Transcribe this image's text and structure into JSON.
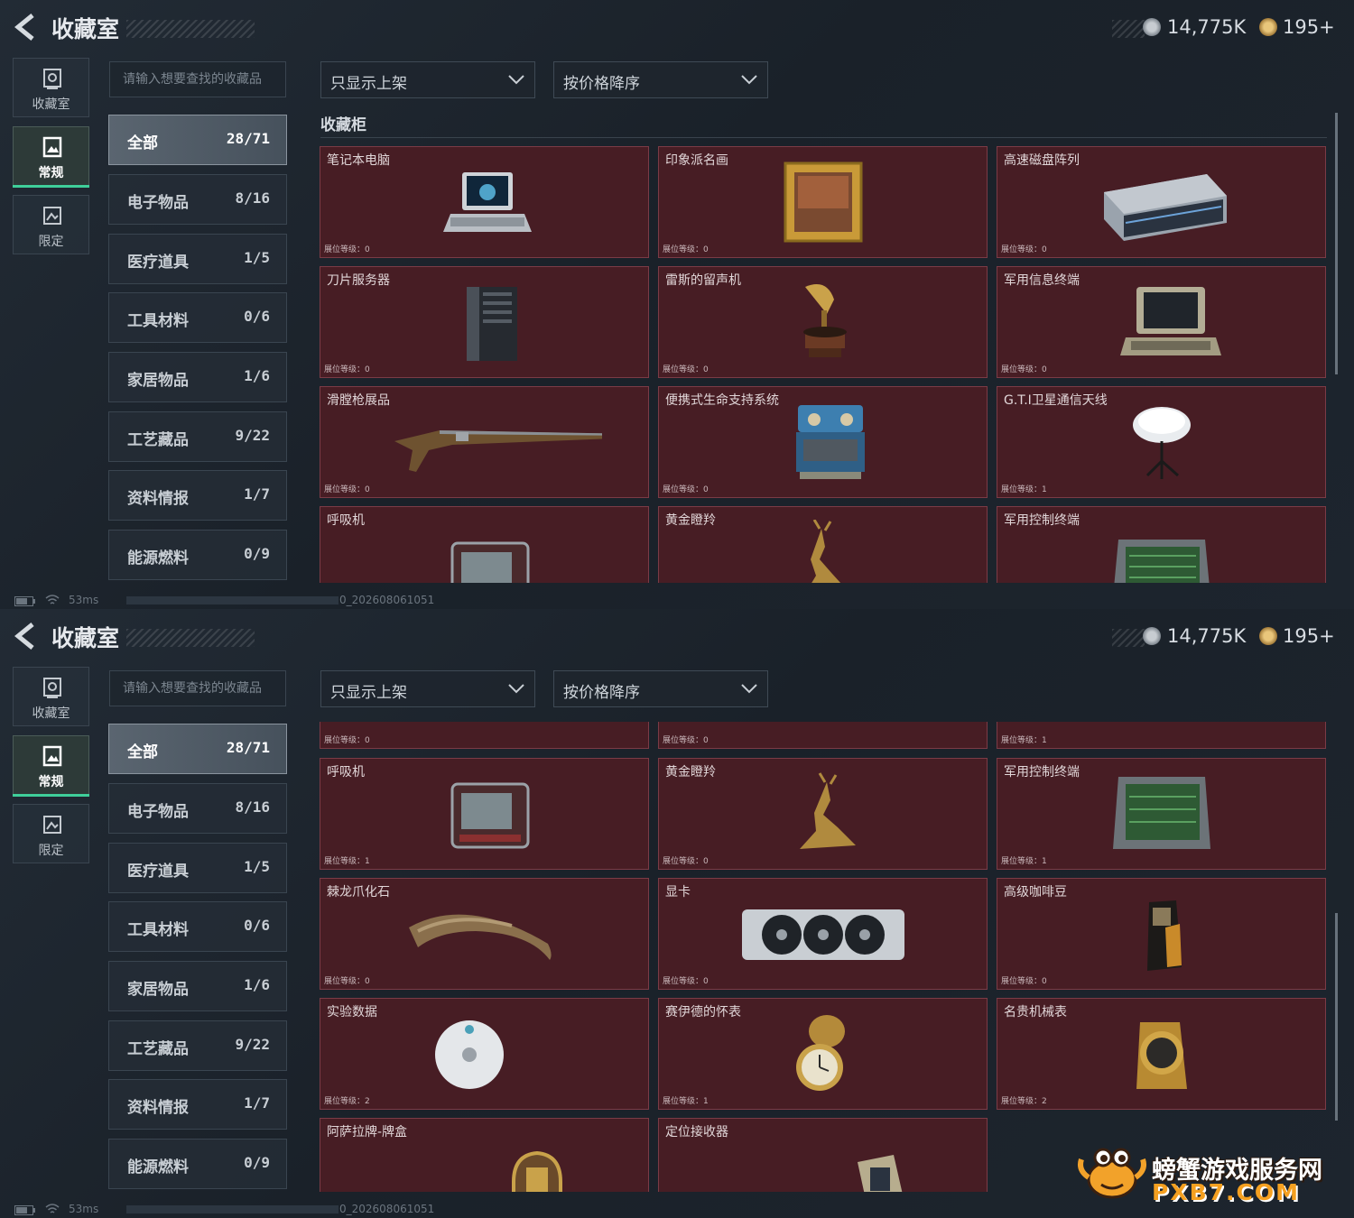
{
  "header": {
    "title": "收藏室",
    "currency": "14,775K",
    "coins": "195+"
  },
  "nav": [
    {
      "label": "收藏室",
      "icon": "vault-icon"
    },
    {
      "label": "常规",
      "icon": "picture-frame-icon",
      "active": true
    },
    {
      "label": "限定",
      "icon": "limited-image-icon"
    }
  ],
  "search": {
    "placeholder": "请输入想要查找的收藏品"
  },
  "filters": {
    "display": "只显示上架",
    "sort": "按价格降序"
  },
  "section_title": "收藏柜",
  "categories": [
    {
      "name": "全部",
      "count": "28/71",
      "active": true
    },
    {
      "name": "电子物品",
      "count": "8/16"
    },
    {
      "name": "医疗道具",
      "count": "1/5"
    },
    {
      "name": "工具材料",
      "count": "0/6"
    },
    {
      "name": "家居物品",
      "count": "1/6"
    },
    {
      "name": "工艺藏品",
      "count": "9/22"
    },
    {
      "name": "资料情报",
      "count": "1/7"
    },
    {
      "name": "能源燃料",
      "count": "0/9"
    }
  ],
  "level_label": "展位等级：",
  "items": [
    {
      "name": "笔记本电脑",
      "level": "0",
      "icon": "laptop-icon"
    },
    {
      "name": "印象派名画",
      "level": "0",
      "icon": "painting-icon"
    },
    {
      "name": "高速磁盘阵列",
      "level": "0",
      "icon": "disk-array-icon"
    },
    {
      "name": "刀片服务器",
      "level": "0",
      "icon": "server-icon"
    },
    {
      "name": "雷斯的留声机",
      "level": "0",
      "icon": "gramophone-icon"
    },
    {
      "name": "军用信息终端",
      "level": "0",
      "icon": "rugged-terminal-icon"
    },
    {
      "name": "滑膛枪展品",
      "level": "0",
      "icon": "musket-icon"
    },
    {
      "name": "便携式生命支持系统",
      "level": "0",
      "icon": "life-support-icon"
    },
    {
      "name": "G.T.I卫星通信天线",
      "level": "1",
      "icon": "satellite-dish-icon"
    },
    {
      "name": "呼吸机",
      "level": "1",
      "icon": "ventilator-icon"
    },
    {
      "name": "黄金瞪羚",
      "level": "0",
      "icon": "gold-gazelle-icon"
    },
    {
      "name": "军用控制终端",
      "level": "1",
      "icon": "control-terminal-icon"
    },
    {
      "name": "棘龙爪化石",
      "level": "0",
      "icon": "claw-fossil-icon"
    },
    {
      "name": "显卡",
      "level": "0",
      "icon": "graphics-card-icon"
    },
    {
      "name": "高级咖啡豆",
      "level": "0",
      "icon": "coffee-bag-icon"
    },
    {
      "name": "实验数据",
      "level": "2",
      "icon": "disc-icon"
    },
    {
      "name": "赛伊德的怀表",
      "level": "1",
      "icon": "pocket-watch-icon"
    },
    {
      "name": "名贵机械表",
      "level": "2",
      "icon": "wristwatch-icon"
    },
    {
      "name": "阿萨拉牌-牌盒",
      "level": "",
      "icon": "card-box-icon"
    },
    {
      "name": "定位接收器",
      "level": "",
      "icon": "receiver-icon"
    }
  ],
  "status": {
    "ping": "53ms",
    "build": "0_202608061051"
  },
  "watermark": {
    "line1": "螃蟹游戏服务网",
    "line2": "PXB7.COM"
  },
  "colors": {
    "card_bg": "#471d24",
    "card_border": "#7b3b46",
    "active_nav": "#3fcf9a"
  }
}
